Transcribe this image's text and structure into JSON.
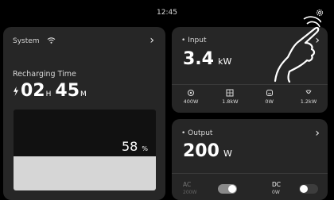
{
  "status": {
    "time": "12:45"
  },
  "system": {
    "label": "System",
    "recharging_label": "Recharging Time",
    "hours": "02",
    "hours_unit": "H",
    "minutes": "45",
    "minutes_unit": "M",
    "battery_percent": "58",
    "battery_unit": "%",
    "battery_level": 0.42
  },
  "input": {
    "label": "Input",
    "value": "3.4",
    "unit": "kW",
    "sources": [
      {
        "icon": "solar-icon",
        "value": "400W"
      },
      {
        "icon": "panel-icon",
        "value": "1.8kW"
      },
      {
        "icon": "car-icon",
        "value": "0W"
      },
      {
        "icon": "plug-icon",
        "value": "1.2kW"
      }
    ]
  },
  "output": {
    "label": "Output",
    "value": "200",
    "unit": "W",
    "ac_label": "AC",
    "ac_value": "200W",
    "dc_label": "DC",
    "dc_value": "0W"
  },
  "colors": {
    "card": "#262626",
    "bar_fill": "#d6d6d6",
    "bar_empty": "#111111"
  }
}
